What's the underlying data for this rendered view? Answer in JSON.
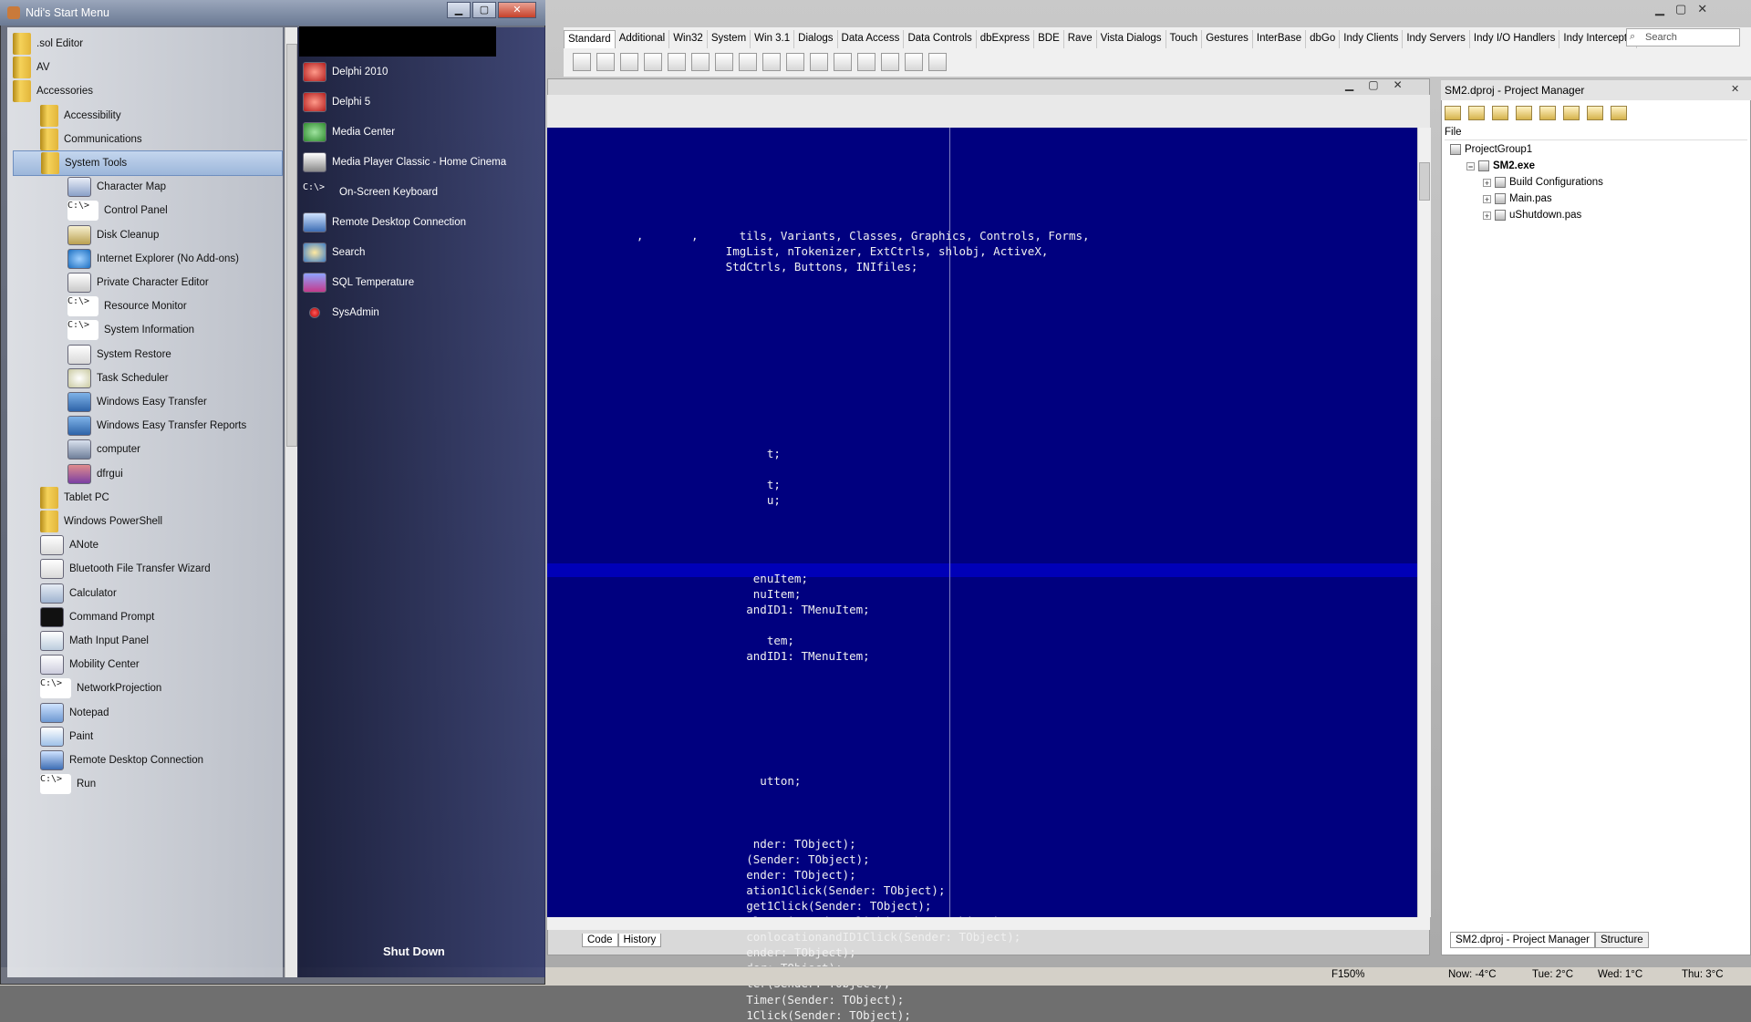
{
  "start_menu": {
    "title": "Ndi's Start Menu",
    "window_controls": {
      "minimize": "▁",
      "maximize": "▢",
      "close": "✕"
    },
    "left_items": [
      {
        "label": ".sol Editor",
        "icon": "folder-icon"
      },
      {
        "label": "AV",
        "icon": "folder-icon"
      },
      {
        "label": "Accessories",
        "icon": "folder-icon"
      },
      {
        "label": "Accessibility",
        "icon": "folder-icon"
      },
      {
        "label": "Communications",
        "icon": "folder-icon"
      },
      {
        "label": "System Tools",
        "icon": "folder-icon",
        "selected": true
      },
      {
        "label": "Character Map",
        "icon": "character-map-icon"
      },
      {
        "label": "Control Panel",
        "icon": "console-icon"
      },
      {
        "label": "Disk Cleanup",
        "icon": "disk-cleanup-icon"
      },
      {
        "label": "Internet Explorer (No Add-ons)",
        "icon": "internet-explorer-icon"
      },
      {
        "label": "Private Character Editor",
        "icon": "character-editor-icon"
      },
      {
        "label": "Resource Monitor",
        "icon": "console-icon"
      },
      {
        "label": "System Information",
        "icon": "console-icon"
      },
      {
        "label": "System Restore",
        "icon": "system-restore-icon"
      },
      {
        "label": "Task Scheduler",
        "icon": "clock-icon"
      },
      {
        "label": "Windows Easy Transfer",
        "icon": "easy-transfer-icon"
      },
      {
        "label": "Windows Easy Transfer Reports",
        "icon": "easy-transfer-icon"
      },
      {
        "label": "computer",
        "icon": "computer-icon"
      },
      {
        "label": "dfrgui",
        "icon": "defrag-icon"
      },
      {
        "label": "Tablet PC",
        "icon": "folder-icon"
      },
      {
        "label": "Windows PowerShell",
        "icon": "folder-icon"
      },
      {
        "label": "ANote",
        "icon": "note-icon"
      },
      {
        "label": "Bluetooth File Transfer Wizard",
        "icon": "bluetooth-icon"
      },
      {
        "label": "Calculator",
        "icon": "calculator-icon"
      },
      {
        "label": "Command Prompt",
        "icon": "command-prompt-icon"
      },
      {
        "label": "Math Input Panel",
        "icon": "math-input-icon"
      },
      {
        "label": "Mobility Center",
        "icon": "mobility-center-icon"
      },
      {
        "label": "NetworkProjection",
        "icon": "console-icon"
      },
      {
        "label": "Notepad",
        "icon": "notepad-icon"
      },
      {
        "label": "Paint",
        "icon": "paint-icon"
      },
      {
        "label": "Remote Desktop Connection",
        "icon": "remote-desktop-icon"
      },
      {
        "label": "Run",
        "icon": "console-icon"
      }
    ],
    "right_items": [
      {
        "label": "Delphi 2010",
        "icon": "delphi-icon"
      },
      {
        "label": "Delphi 5",
        "icon": "delphi-icon"
      },
      {
        "label": "Media Center",
        "icon": "media-center-icon"
      },
      {
        "label": "Media Player Classic - Home Cinema",
        "icon": "media-player-icon"
      },
      {
        "label": "On-Screen Keyboard",
        "icon": "console-icon"
      },
      {
        "label": "Remote Desktop Connection",
        "icon": "remote-desktop-icon"
      },
      {
        "label": "Search",
        "icon": "search-icon"
      },
      {
        "label": "SQL Temperature",
        "icon": "sql-icon"
      },
      {
        "label": "SysAdmin",
        "icon": "sysadmin-icon"
      }
    ],
    "shutdown_label": "Shut Down",
    "console_glyph": "C:\\>"
  },
  "ide": {
    "palette_tabs": [
      "Standard",
      "Additional",
      "Win32",
      "System",
      "Win 3.1",
      "Dialogs",
      "Data Access",
      "Data Controls",
      "dbExpress",
      "BDE",
      "Rave",
      "Vista Dialogs",
      "Touch",
      "Gestures",
      "InterBase",
      "dbGo",
      "Indy Clients",
      "Indy Servers",
      "Indy I/O Handlers",
      "Indy Intercepts"
    ],
    "palette_search_placeholder": "Search",
    "code_lines": [
      "",
      "",
      "",
      "",
      "",
      "",
      "             ,       ,      tils, Variants, Classes, Graphics, Controls, Forms,",
      "                          ImgList, nTokenizer, ExtCtrls, shlobj, ActiveX,",
      "                          StdCtrls, Buttons, INIfiles;",
      "",
      "",
      "",
      "",
      "",
      "",
      "",
      "",
      "",
      "",
      "",
      "                                t;",
      "",
      "                                t;",
      "                                u;",
      "",
      "",
      "",
      "",
      "                              enuItem;",
      "                              nuItem;",
      "                             andID1: TMenuItem;",
      "",
      "                                tem;",
      "                             andID1: TMenuItem;",
      "",
      "",
      "",
      "",
      "",
      "",
      "",
      "                               utton;",
      "",
      "",
      "",
      "                              nder: TObject);",
      "                             (Sender: TObject);",
      "                             ender: TObject);",
      "                             ation1Click(Sender: TObject);",
      "                             get1Click(Sender: TObject);",
      "                             nlocationandID1Click(Sender: TObject);",
      "                             conlocationandID1Click(Sender: TObject);",
      "                             ender: TObject);",
      "                             der: TObject);",
      "                             ter(Sender: TObject);",
      "                             Timer(Sender: TObject);",
      "                             1Click(Sender: TObject);"
    ],
    "editor_bottom_tabs": [
      "Code",
      "History"
    ],
    "project_manager": {
      "title": "SM2.dproj - Project Manager",
      "column_header": "File",
      "tree": [
        {
          "label": "ProjectGroup1",
          "level": 0,
          "bold": false
        },
        {
          "label": "SM2.exe",
          "level": 1,
          "bold": true
        },
        {
          "label": "Build Configurations",
          "level": 2,
          "bold": false
        },
        {
          "label": "Main.pas",
          "level": 2,
          "bold": false
        },
        {
          "label": "uShutdown.pas",
          "level": 2,
          "bold": false
        }
      ],
      "bottom_tabs": [
        "SM2.dproj - Project Manager",
        "Structure"
      ]
    },
    "status_bar": {
      "zoom": "F150%",
      "now": "Now: -4°C",
      "tue": "Tue: 2°C",
      "wed": "Wed: 1°C",
      "thu": "Thu: 3°C"
    }
  },
  "colors": {
    "editor_bg": "#00007f",
    "editor_text": "#f0f0f0"
  }
}
